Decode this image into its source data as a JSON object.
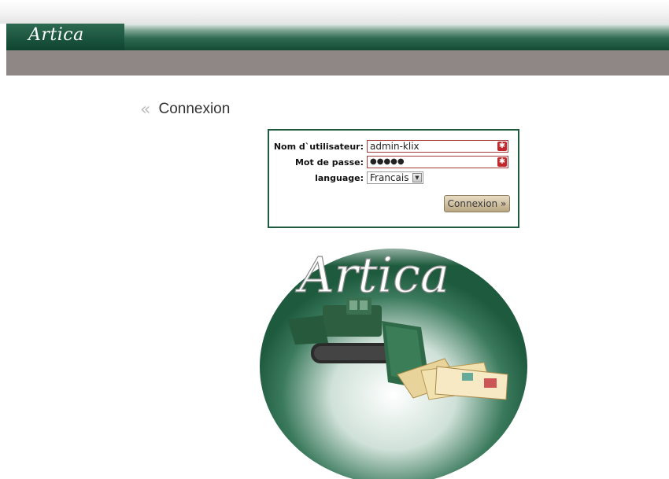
{
  "app": {
    "logo_text": "Artica"
  },
  "page": {
    "title_chevron": "«",
    "title": "Connexion"
  },
  "login": {
    "username_label": "Nom d`utilisateur:",
    "username_value": "admin-klix",
    "password_label": "Mot de passe:",
    "password_value": "●●●●●",
    "language_label": "language:",
    "language_value": "Francais",
    "required_mark": "✱",
    "submit_label": "Connexion »"
  },
  "brand_art": {
    "logo_text": "Artica"
  },
  "colors": {
    "header_green": "#144a34",
    "brand_bar": "#8f8785",
    "box_border": "#1e5a3e",
    "required_red": "#c0282c"
  }
}
